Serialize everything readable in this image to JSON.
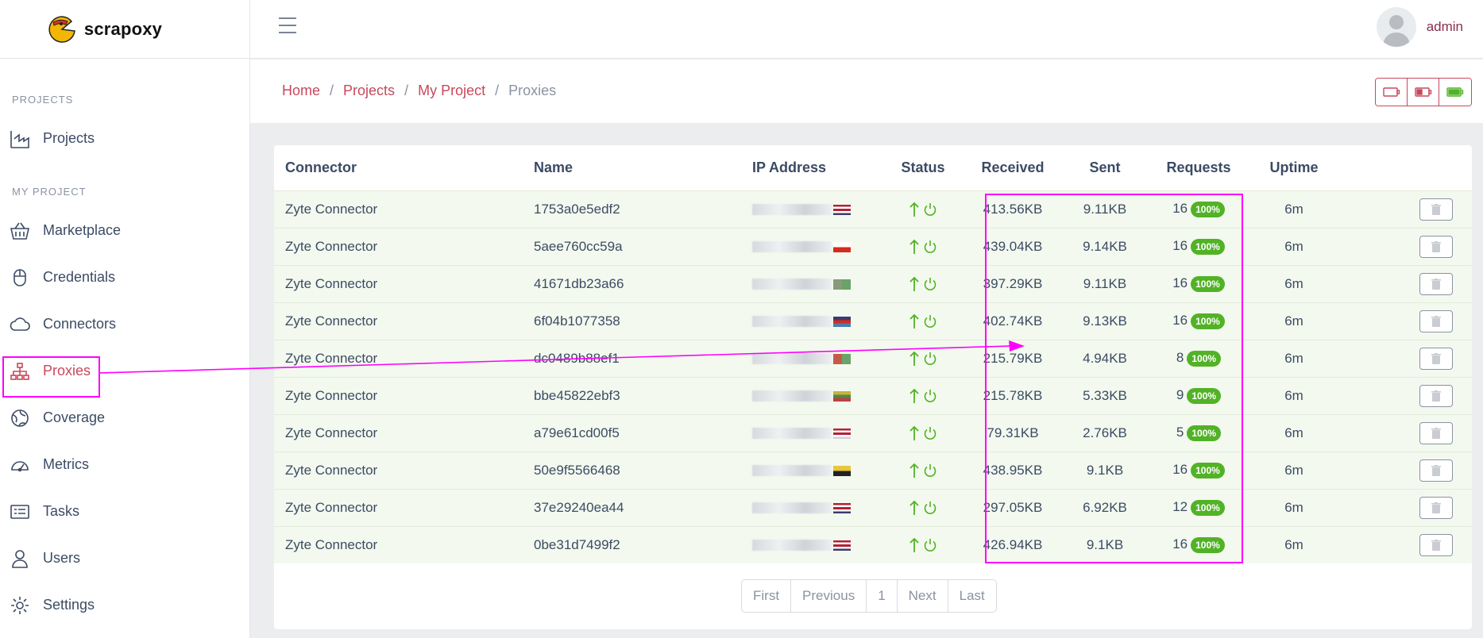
{
  "brand": {
    "name": "scrapoxy"
  },
  "header": {
    "user": "admin"
  },
  "sidebar": {
    "sections": [
      {
        "title": "PROJECTS",
        "items": [
          {
            "label": "Projects",
            "icon": "factory-icon"
          }
        ]
      },
      {
        "title": "MY PROJECT",
        "items": [
          {
            "label": "Marketplace",
            "icon": "basket-icon"
          },
          {
            "label": "Credentials",
            "icon": "mouse-icon"
          },
          {
            "label": "Connectors",
            "icon": "cloud-icon"
          },
          {
            "label": "Proxies",
            "icon": "sitemap-icon",
            "active": true
          },
          {
            "label": "Coverage",
            "icon": "globe-icon"
          },
          {
            "label": "Metrics",
            "icon": "speedometer-icon"
          },
          {
            "label": "Tasks",
            "icon": "task-icon"
          },
          {
            "label": "Users",
            "icon": "user-icon"
          },
          {
            "label": "Settings",
            "icon": "gear-icon"
          }
        ]
      }
    ]
  },
  "breadcrumb": {
    "home": "Home",
    "projects": "Projects",
    "project": "My Project",
    "current": "Proxies"
  },
  "table": {
    "columns": [
      "Connector",
      "Name",
      "IP Address",
      "Status",
      "Received",
      "Sent",
      "Requests",
      "Uptime"
    ],
    "rows": [
      {
        "connector": "Zyte Connector",
        "name": "1753a0e5edf2",
        "received": "413.56KB",
        "sent": "9.11KB",
        "requests": "16",
        "success": "100%",
        "uptime": "6m"
      },
      {
        "connector": "Zyte Connector",
        "name": "5aee760cc59a",
        "received": "439.04KB",
        "sent": "9.14KB",
        "requests": "16",
        "success": "100%",
        "uptime": "6m"
      },
      {
        "connector": "Zyte Connector",
        "name": "41671db23a66",
        "received": "397.29KB",
        "sent": "9.11KB",
        "requests": "16",
        "success": "100%",
        "uptime": "6m"
      },
      {
        "connector": "Zyte Connector",
        "name": "6f04b1077358",
        "received": "402.74KB",
        "sent": "9.13KB",
        "requests": "16",
        "success": "100%",
        "uptime": "6m"
      },
      {
        "connector": "Zyte Connector",
        "name": "dc0489b88ef1",
        "received": "215.79KB",
        "sent": "4.94KB",
        "requests": "8",
        "success": "100%",
        "uptime": "6m"
      },
      {
        "connector": "Zyte Connector",
        "name": "bbe45822ebf3",
        "received": "215.78KB",
        "sent": "5.33KB",
        "requests": "9",
        "success": "100%",
        "uptime": "6m"
      },
      {
        "connector": "Zyte Connector",
        "name": "a79e61cd00f5",
        "received": "79.31KB",
        "sent": "2.76KB",
        "requests": "5",
        "success": "100%",
        "uptime": "6m"
      },
      {
        "connector": "Zyte Connector",
        "name": "50e9f5566468",
        "received": "438.95KB",
        "sent": "9.1KB",
        "requests": "16",
        "success": "100%",
        "uptime": "6m"
      },
      {
        "connector": "Zyte Connector",
        "name": "37e29240ea44",
        "received": "297.05KB",
        "sent": "6.92KB",
        "requests": "12",
        "success": "100%",
        "uptime": "6m"
      },
      {
        "connector": "Zyte Connector",
        "name": "0be31d7499f2",
        "received": "426.94KB",
        "sent": "9.1KB",
        "requests": "16",
        "success": "100%",
        "uptime": "6m"
      }
    ]
  },
  "pagination": {
    "first": "First",
    "previous": "Previous",
    "page": "1",
    "next": "Next",
    "last": "Last"
  },
  "colors": {
    "accent": "#c8485b",
    "success": "#52b227",
    "annotation": "#ff00ff",
    "row_bg": "#f3f9ee"
  }
}
